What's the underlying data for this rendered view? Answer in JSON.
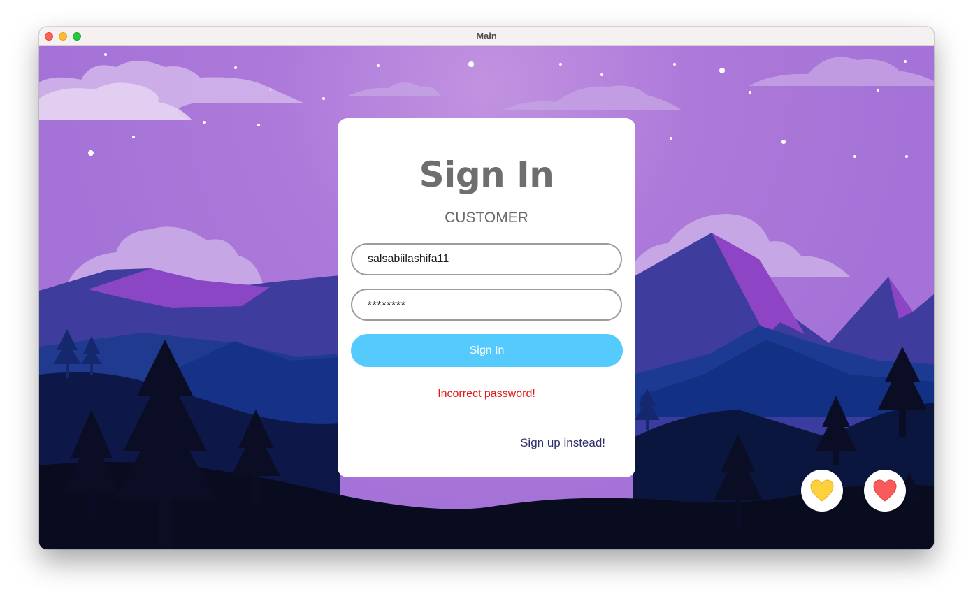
{
  "window": {
    "title": "Main"
  },
  "login": {
    "title": "Sign In",
    "subtitle": "CUSTOMER",
    "username_value": "salsabiilashifa11",
    "password_value": "********",
    "signin_label": "Sign In",
    "error_message": "Incorrect password!",
    "signup_label": "Sign up instead!"
  },
  "colors": {
    "button_primary": "#55cbfd",
    "error": "#e01818",
    "sky": "#a673d8",
    "heart_yellow": "#fdd13b",
    "heart_red": "#fb5a5a"
  },
  "icons": {
    "yellow_button": "yellow-heart-icon",
    "red_button": "red-heart-icon"
  }
}
